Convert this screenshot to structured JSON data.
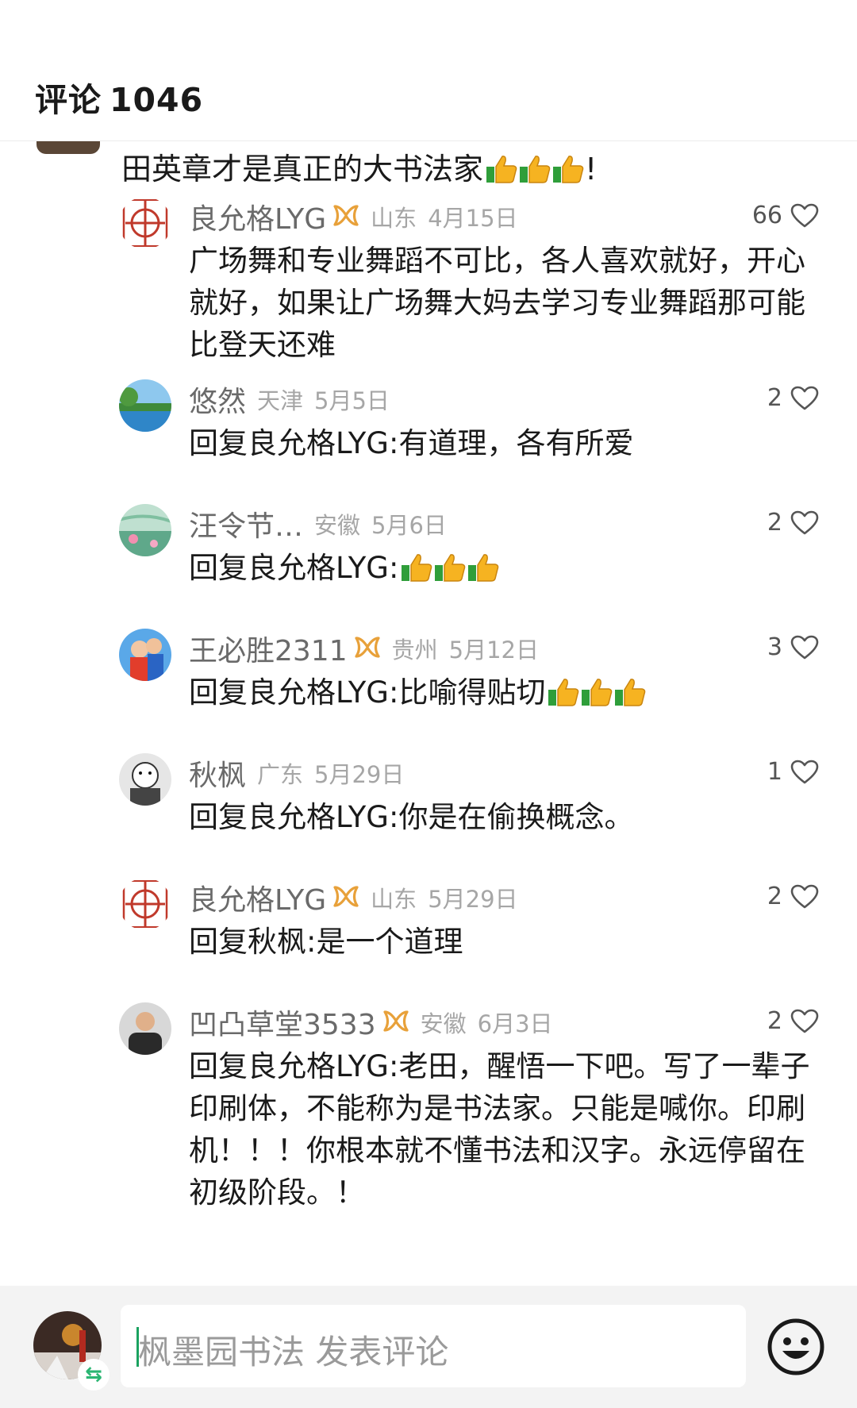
{
  "header": {
    "title": "评论",
    "count": "1046"
  },
  "parent": {
    "text": "田英章才是真正的大书法家",
    "suffix": "!"
  },
  "replies": [
    {
      "user": "良允格LYG",
      "verified": true,
      "location": "山东",
      "date": "4月15日",
      "likes": "66",
      "prefix": "",
      "target": "",
      "text": "广场舞和专业舞蹈不可比，各人喜欢就好，开心就好，如果让广场舞大妈去学习专业舞蹈那可能比登天还难",
      "thumbs": 0,
      "avatar": "seal-icon"
    },
    {
      "user": "悠然",
      "verified": false,
      "location": "天津",
      "date": "5月5日",
      "likes": "2",
      "prefix": "回复",
      "target": "良允格LYG:",
      "text": "有道理，各有所爱",
      "thumbs": 0,
      "avatar": "lake-avatar"
    },
    {
      "user": "汪令节…",
      "verified": false,
      "location": "安徽",
      "date": "5月6日",
      "likes": "2",
      "prefix": "回复",
      "target": "良允格LYG:",
      "text": "",
      "thumbs": 3,
      "avatar": "lotus-avatar"
    },
    {
      "user": "王必胜2311",
      "verified": true,
      "location": "贵州",
      "date": "5月12日",
      "likes": "3",
      "prefix": "回复",
      "target": "良允格LYG:",
      "text": "比喻得贴切",
      "thumbs": 3,
      "avatar": "family-avatar"
    },
    {
      "user": "秋枫",
      "verified": false,
      "location": "广东",
      "date": "5月29日",
      "likes": "1",
      "prefix": "回复",
      "target": "良允格LYG:",
      "text": "你是在偷换概念。",
      "thumbs": 0,
      "avatar": "sketch-avatar"
    },
    {
      "user": "良允格LYG",
      "verified": true,
      "location": "山东",
      "date": "5月29日",
      "likes": "2",
      "prefix": "回复",
      "target": "秋枫:",
      "text": "是一个道理",
      "thumbs": 0,
      "avatar": "seal-icon"
    },
    {
      "user": "凹凸草堂3533",
      "verified": true,
      "location": "安徽",
      "date": "6月3日",
      "likes": "2",
      "prefix": "回复",
      "target": "良允格LYG:",
      "text": "老田，醒悟一下吧。写了一辈子印刷体，不能称为是书法家。只能是喊你。印刷机！！！你根本就不懂书法和汉字。永远停留在初级阶段。！",
      "thumbs": 0,
      "avatar": "man-avatar"
    }
  ],
  "composer": {
    "placeholder": "枫墨园书法 发表评论"
  },
  "colors": {
    "badge": "#e8a13a",
    "heart": "#555555",
    "caret": "#1aa260"
  }
}
